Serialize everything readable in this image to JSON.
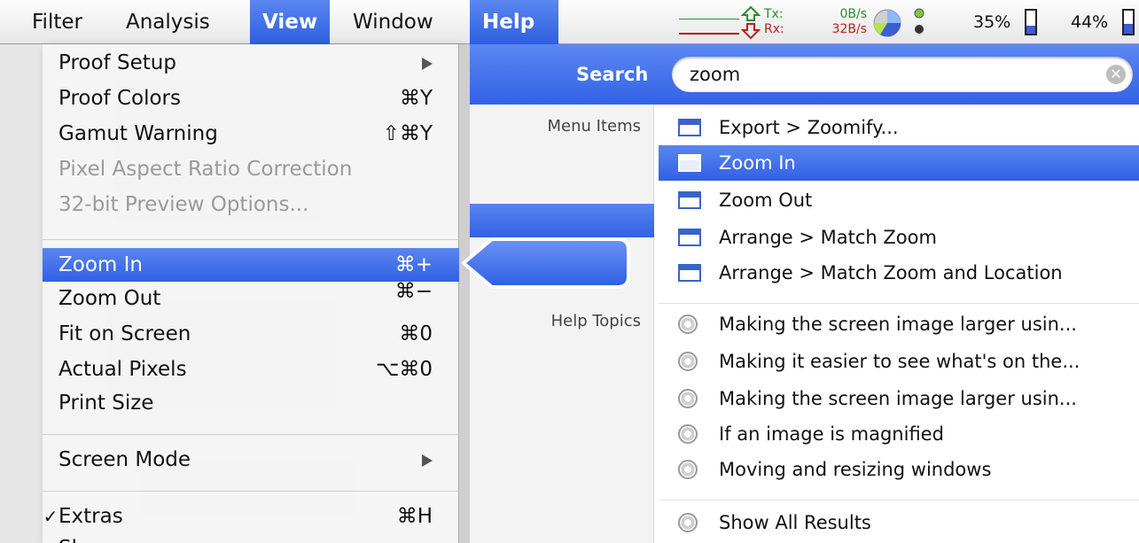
{
  "menubar": {
    "items": [
      "Filter",
      "Analysis",
      "View",
      "Window",
      "Help"
    ]
  },
  "status": {
    "tx_label": "Tx:",
    "rx_label": "Rx:",
    "tx_rate": "0B/s",
    "rx_rate": "32B/s",
    "cpu_pct": "35%",
    "batt_pct": "44%",
    "batt_level": 0.35,
    "batt2_level": 0.44
  },
  "view_menu": {
    "items": [
      {
        "label": "Proof Setup",
        "shortcut": "",
        "submenu": true
      },
      {
        "label": "Proof Colors",
        "shortcut": "⌘Y"
      },
      {
        "label": "Gamut Warning",
        "shortcut": "⇧⌘Y"
      },
      {
        "label": "Pixel Aspect Ratio Correction",
        "shortcut": "",
        "disabled": true
      },
      {
        "label": "32-bit Preview Options...",
        "shortcut": "",
        "disabled": true
      },
      {
        "label": "Zoom In",
        "shortcut": "⌘+",
        "selected": true
      },
      {
        "label": "Zoom Out",
        "shortcut": "⌘−"
      },
      {
        "label": "Fit on Screen",
        "shortcut": "⌘0"
      },
      {
        "label": "Actual Pixels",
        "shortcut": "⌥⌘0"
      },
      {
        "label": "Print Size",
        "shortcut": ""
      },
      {
        "label": "Screen Mode",
        "shortcut": "",
        "submenu": true
      },
      {
        "label": "Extras",
        "shortcut": "⌘H",
        "checked": true
      },
      {
        "label": "Show",
        "shortcut": ""
      }
    ],
    "check_mark": "✓"
  },
  "help": {
    "search_label": "Search",
    "search_value": "zoom",
    "clear_glyph": "✕",
    "menu_items_label": "Menu Items",
    "help_topics_label": "Help Topics",
    "menu_results": [
      "Export > Zoomify...",
      "Zoom In",
      "Zoom Out",
      "Arrange > Match Zoom",
      "Arrange > Match Zoom and Location"
    ],
    "topic_results": [
      "Making the screen image larger usin...",
      "Making it easier to see what's on the...",
      "Making the screen image larger usin...",
      "If an image is magnified",
      "Moving and resizing windows"
    ],
    "show_all": "Show All Results"
  },
  "colors": {
    "accent": "#3462e6",
    "tx_green": "#2e8b2e",
    "rx_red": "#b22222"
  },
  "icons": [
    "menu-item-icon",
    "help-topic-icon",
    "clear-search-icon",
    "submenu-arrow-icon",
    "upload-arrow-icon",
    "download-arrow-icon",
    "cpu-pie-icon",
    "battery-icon"
  ]
}
